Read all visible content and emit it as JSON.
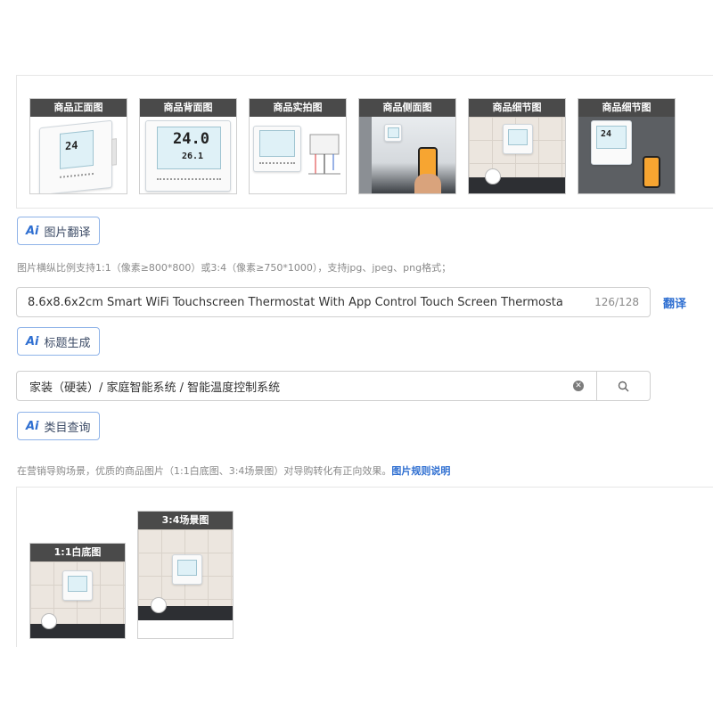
{
  "thumbnails": [
    {
      "label": "商品正面图"
    },
    {
      "label": "商品背面图"
    },
    {
      "label": "商品实拍图"
    },
    {
      "label": "商品侧面图"
    },
    {
      "label": "商品细节图"
    },
    {
      "label": "商品细节图"
    }
  ],
  "device_readings": {
    "temp_main": "24.0",
    "temp_sub": "26.1",
    "temp_short": "24"
  },
  "buttons": {
    "translate_image": "图片翻译",
    "title_generate": "标题生成",
    "category_query": "类目查询",
    "ai_mark": "Ai"
  },
  "image_hint": "图片横纵比例支持1:1（像素≥800*800）或3:4（像素≥750*1000），支持jpg、jpeg、png格式；",
  "title_field": {
    "value": "8.6x8.6x2cm Smart WiFi Touchscreen Thermostat With App Control Touch Screen Thermosta",
    "counter": "126/128",
    "translate_link": "翻译"
  },
  "category_field": {
    "value": "家装（硬装）/ 家庭智能系统 / 智能温度控制系统"
  },
  "marketing_hint": {
    "text": "在营销导购场景，优质的商品图片（1:1白底图、3:4场景图）对导购转化有正向效果。",
    "link": "图片规则说明"
  },
  "bottom_images": [
    {
      "label": "1:1白底图"
    },
    {
      "label": "3:4场景图"
    }
  ],
  "colors": {
    "accent": "#2f6fd1",
    "tag_bg": "#4a4a4a",
    "border": "#cfcfcf"
  }
}
